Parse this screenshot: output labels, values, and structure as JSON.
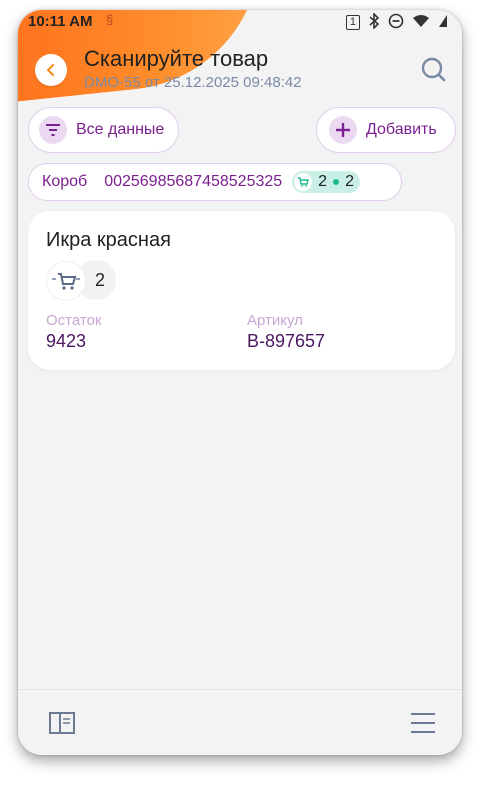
{
  "status_bar": {
    "time": "10:11 AM",
    "sim": "1"
  },
  "header": {
    "title": "Сканируйте товар",
    "subtitle": "DMO-55 от 25.12.2025 09:48:42"
  },
  "toolbar": {
    "filter_label": "Все данные",
    "add_label": "Добавить"
  },
  "box": {
    "label": "Короб",
    "code": "00256985687458525325",
    "scanned_count": "2",
    "total_count": "2"
  },
  "product": {
    "name": "Икра красная",
    "quantity": "2",
    "stock_label": "Остаток",
    "stock_value": "9423",
    "article_label": "Артикул",
    "article_value": "B-897657"
  },
  "colors": {
    "accent": "#7a2090",
    "brand_orange": "#ff8a1a",
    "badge_green": "#1fb98f"
  }
}
